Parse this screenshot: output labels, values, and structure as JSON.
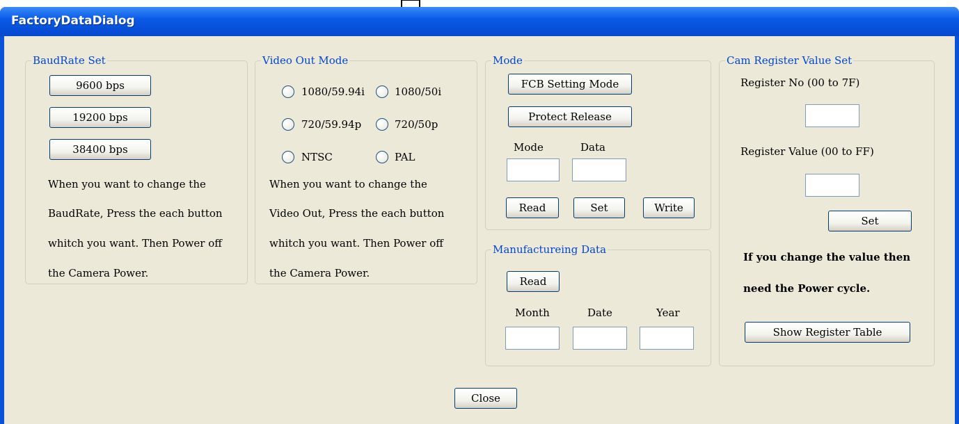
{
  "window": {
    "title": "FactoryDataDialog"
  },
  "baudrate": {
    "legend": "BaudRate Set",
    "buttons": [
      "9600 bps",
      "19200 bps",
      "38400 bps"
    ],
    "help": [
      "When you want to change the",
      "BaudRate, Press the each button",
      "whitch you want. Then Power off",
      "the Camera Power."
    ]
  },
  "videoout": {
    "legend": "Video Out Mode",
    "options": [
      "1080/59.94i",
      "1080/50i",
      "720/59.94p",
      "720/50p",
      "NTSC",
      "PAL"
    ],
    "help": [
      "When you want to change the",
      "Video Out, Press the each button",
      "whitch you want. Then Power off",
      "the Camera Power."
    ]
  },
  "mode": {
    "legend": "Mode",
    "fcb_button": "FCB Setting Mode",
    "protect_button": "Protect Release",
    "mode_label": "Mode",
    "data_label": "Data",
    "read_button": "Read",
    "set_button": "Set",
    "write_button": "Write"
  },
  "manufacturing": {
    "legend": "Manufactureing Data",
    "read_button": "Read",
    "month_label": "Month",
    "date_label": "Date",
    "year_label": "Year"
  },
  "camregister": {
    "legend": "Cam Register Value Set",
    "regno_label": "Register No (00 to 7F)",
    "regval_label": "Register Value (00 to FF)",
    "set_button": "Set",
    "note1": "If you change the value then",
    "note2": "need the Power cycle.",
    "show_button": "Show Register Table"
  },
  "footer": {
    "close_button": "Close"
  }
}
